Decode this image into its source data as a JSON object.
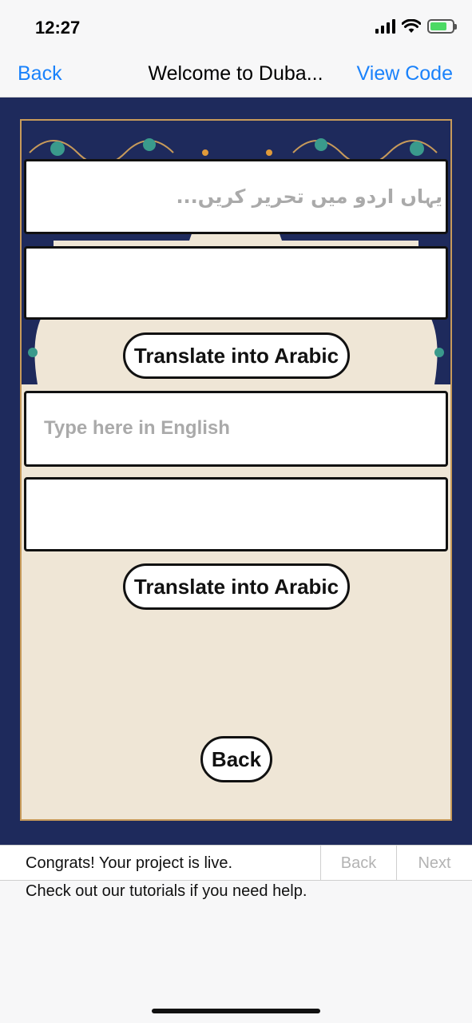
{
  "status_bar": {
    "time": "12:27"
  },
  "nav": {
    "back_label": "Back",
    "title": "Welcome to Duba...",
    "view_code_label": "View Code",
    "accent_color": "#1a82fb"
  },
  "app": {
    "background_color": "#1e2a5c",
    "card_color": "#efe6d6",
    "urdu_input": {
      "placeholder": "یہاں اردو میں تحریر کریں...",
      "value": ""
    },
    "urdu_output": {
      "value": ""
    },
    "translate_button_1": "Translate into Arabic",
    "english_input": {
      "placeholder": "Type here in English",
      "value": ""
    },
    "english_output": {
      "value": ""
    },
    "translate_button_2": "Translate into Arabic",
    "back_button": "Back"
  },
  "bottom_panel": {
    "congrats": "Congrats! Your project is live.",
    "pager_back": "Back",
    "pager_next": "Next",
    "help": "Check out our tutorials if you need help."
  }
}
